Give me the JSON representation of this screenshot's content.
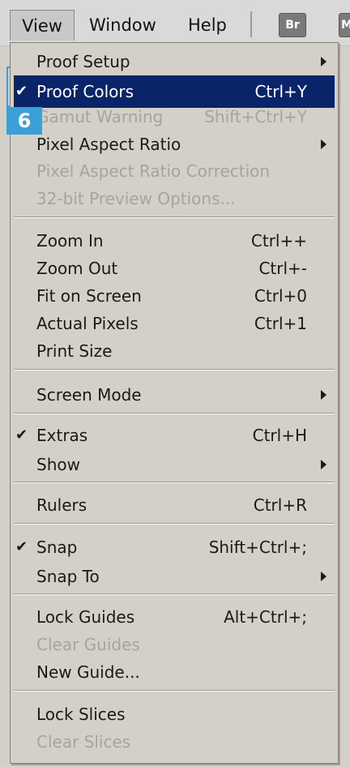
{
  "menubar": {
    "items": [
      "View",
      "Window",
      "Help"
    ],
    "icons": {
      "br": "Br",
      "m": "M"
    }
  },
  "callout": {
    "number": "6",
    "color": "#3aa0d8"
  },
  "highlight_color": "#0a246a",
  "menu": {
    "items": [
      {
        "label": "Proof Setup",
        "submenu": true
      },
      {
        "label": "Proof Colors",
        "shortcut": "Ctrl+Y",
        "checked": true,
        "highlighted": true
      },
      {
        "label": "Gamut Warning",
        "shortcut": "Shift+Ctrl+Y",
        "disabled": true
      },
      {
        "label": "Pixel Aspect Ratio",
        "submenu": true
      },
      {
        "label": "Pixel Aspect Ratio Correction",
        "disabled": true
      },
      {
        "label": "32-bit Preview Options...",
        "disabled": true
      },
      {
        "label": "Zoom In",
        "shortcut": "Ctrl++"
      },
      {
        "label": "Zoom Out",
        "shortcut": "Ctrl+-"
      },
      {
        "label": "Fit on Screen",
        "shortcut": "Ctrl+0"
      },
      {
        "label": "Actual Pixels",
        "shortcut": "Ctrl+1"
      },
      {
        "label": "Print Size"
      },
      {
        "label": "Screen Mode",
        "submenu": true
      },
      {
        "label": "Extras",
        "shortcut": "Ctrl+H",
        "checked": true
      },
      {
        "label": "Show",
        "submenu": true
      },
      {
        "label": "Rulers",
        "shortcut": "Ctrl+R"
      },
      {
        "label": "Snap",
        "shortcut": "Shift+Ctrl+;",
        "checked": true
      },
      {
        "label": "Snap To",
        "submenu": true
      },
      {
        "label": "Lock Guides",
        "shortcut": "Alt+Ctrl+;"
      },
      {
        "label": "Clear Guides",
        "disabled": true
      },
      {
        "label": "New Guide..."
      },
      {
        "label": "Lock Slices"
      },
      {
        "label": "Clear Slices",
        "disabled": true
      }
    ]
  }
}
